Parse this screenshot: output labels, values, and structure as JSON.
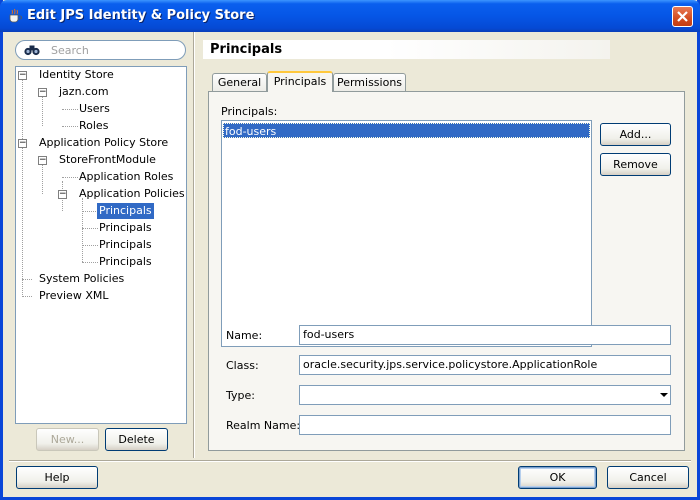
{
  "window": {
    "title": "Edit JPS Identity & Policy Store"
  },
  "search": {
    "placeholder": "Search"
  },
  "tree": {
    "identity_store": "Identity Store",
    "jazn": "jazn.com",
    "users": "Users",
    "roles": "Roles",
    "app_policy_store": "Application Policy Store",
    "storefront": "StoreFrontModule",
    "app_roles": "Application Roles",
    "app_policies": "Application Policies",
    "principals": [
      "Principals",
      "Principals",
      "Principals",
      "Principals"
    ],
    "system_policies": "System Policies",
    "preview_xml": "Preview XML"
  },
  "left_buttons": {
    "new": "New...",
    "delete": "Delete"
  },
  "header": {
    "title": "Principals"
  },
  "tabs": [
    {
      "label": "General"
    },
    {
      "label": "Principals"
    },
    {
      "label": "Permissions"
    }
  ],
  "principals_panel": {
    "list_label": "Principals:",
    "items": [
      "fod-users"
    ],
    "add_button": "Add...",
    "remove_button": "Remove",
    "name_label": "Name:",
    "name_value": "fod-users",
    "class_label": "Class:",
    "class_value": "oracle.security.jps.service.policystore.ApplicationRole",
    "type_label": "Type:",
    "type_value": "",
    "realm_label": "Realm Name:",
    "realm_value": ""
  },
  "footer": {
    "help": "Help",
    "ok": "OK",
    "cancel": "Cancel"
  },
  "colors": {
    "titlebar": "#0a5fee",
    "selection": "#316ac5",
    "dialog_bg": "#ece9d8"
  }
}
